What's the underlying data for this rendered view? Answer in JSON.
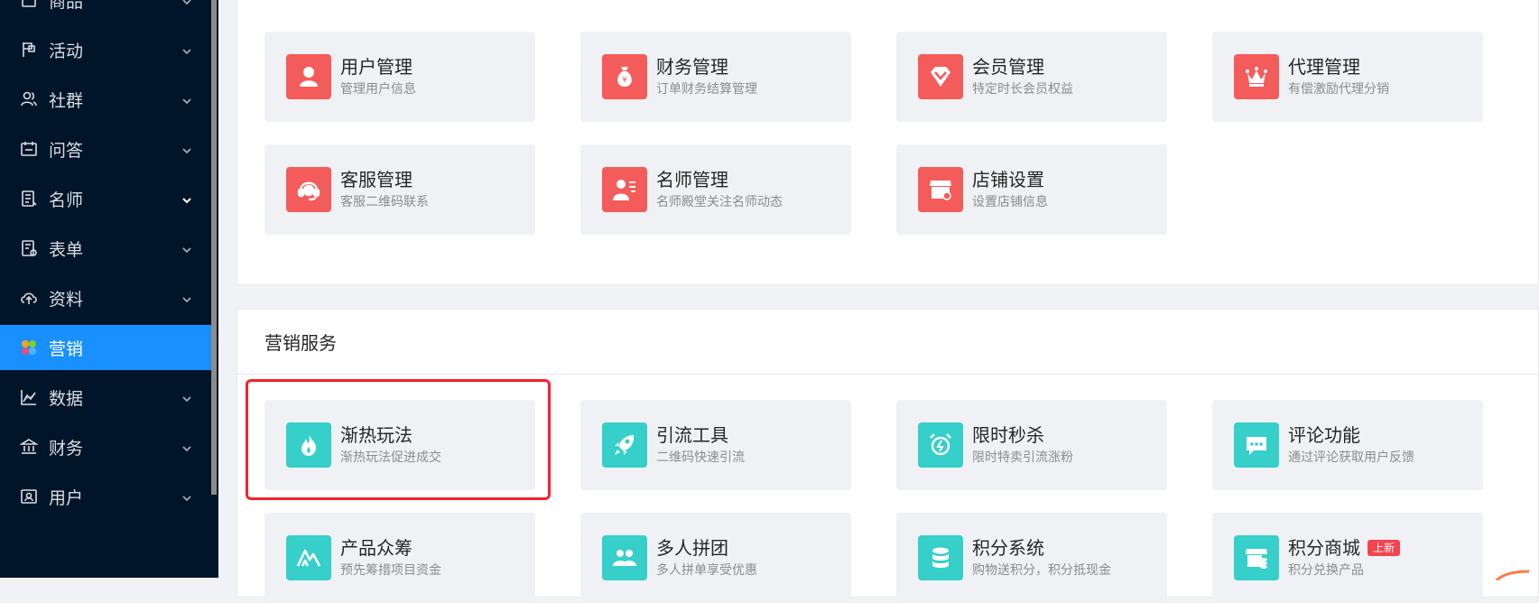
{
  "sidebar": {
    "items": [
      {
        "label": "商品",
        "icon": "product-icon",
        "active": false
      },
      {
        "label": "活动",
        "icon": "flag-icon",
        "active": false
      },
      {
        "label": "社群",
        "icon": "users-icon",
        "active": false
      },
      {
        "label": "问答",
        "icon": "calendar-chat-icon",
        "active": false
      },
      {
        "label": "名师",
        "icon": "teacher-doc-icon",
        "active": false
      },
      {
        "label": "表单",
        "icon": "form-icon",
        "active": false
      },
      {
        "label": "资料",
        "icon": "cloud-upload-icon",
        "active": false
      },
      {
        "label": "营销",
        "icon": "apps-colorful-icon",
        "active": true
      },
      {
        "label": "数据",
        "icon": "chart-icon",
        "active": false
      },
      {
        "label": "财务",
        "icon": "bank-icon",
        "active": false
      },
      {
        "label": "用户",
        "icon": "user-card-icon",
        "active": false
      }
    ],
    "active_color": "#1890ff",
    "bg_color": "#001529"
  },
  "top_cards": [
    {
      "title": "用户管理",
      "sub": "管理用户信息",
      "icon": "user-icon"
    },
    {
      "title": "财务管理",
      "sub": "订单财务结算管理",
      "icon": "money-bag-icon"
    },
    {
      "title": "会员管理",
      "sub": "特定时长会员权益",
      "icon": "diamond-icon"
    },
    {
      "title": "代理管理",
      "sub": "有偿激励代理分销",
      "icon": "crown-icon"
    },
    {
      "title": "客服管理",
      "sub": "客服二维码联系",
      "icon": "headset-icon"
    },
    {
      "title": "名师管理",
      "sub": "名师殿堂关注名师动态",
      "icon": "teacher-icon"
    },
    {
      "title": "店铺设置",
      "sub": "设置店铺信息",
      "icon": "shop-settings-icon"
    }
  ],
  "marketing": {
    "header": "营销服务",
    "cards": [
      {
        "title": "渐热玩法",
        "sub": "渐热玩法促进成交",
        "icon": "fire-icon"
      },
      {
        "title": "引流工具",
        "sub": "二维码快速引流",
        "icon": "rocket-icon"
      },
      {
        "title": "限时秒杀",
        "sub": "限时特卖引流涨粉",
        "icon": "alarm-clock-icon"
      },
      {
        "title": "评论功能",
        "sub": "通过评论获取用户反馈",
        "icon": "comment-icon"
      },
      {
        "title": "产品众筹",
        "sub": "预先筹措项目资金",
        "icon": "crowdfunding-icon"
      },
      {
        "title": "多人拼团",
        "sub": "多人拼单享受优惠",
        "icon": "group-icon"
      },
      {
        "title": "积分系统",
        "sub": "购物送积分，积分抵现金",
        "icon": "coins-icon"
      },
      {
        "title": "积分商城",
        "sub": "积分兑换产品",
        "icon": "points-shop-icon",
        "badge": "上新"
      }
    ]
  },
  "colors": {
    "card_red": "#f45b5b",
    "card_teal": "#36cfc9",
    "highlight": "#f5222d"
  }
}
